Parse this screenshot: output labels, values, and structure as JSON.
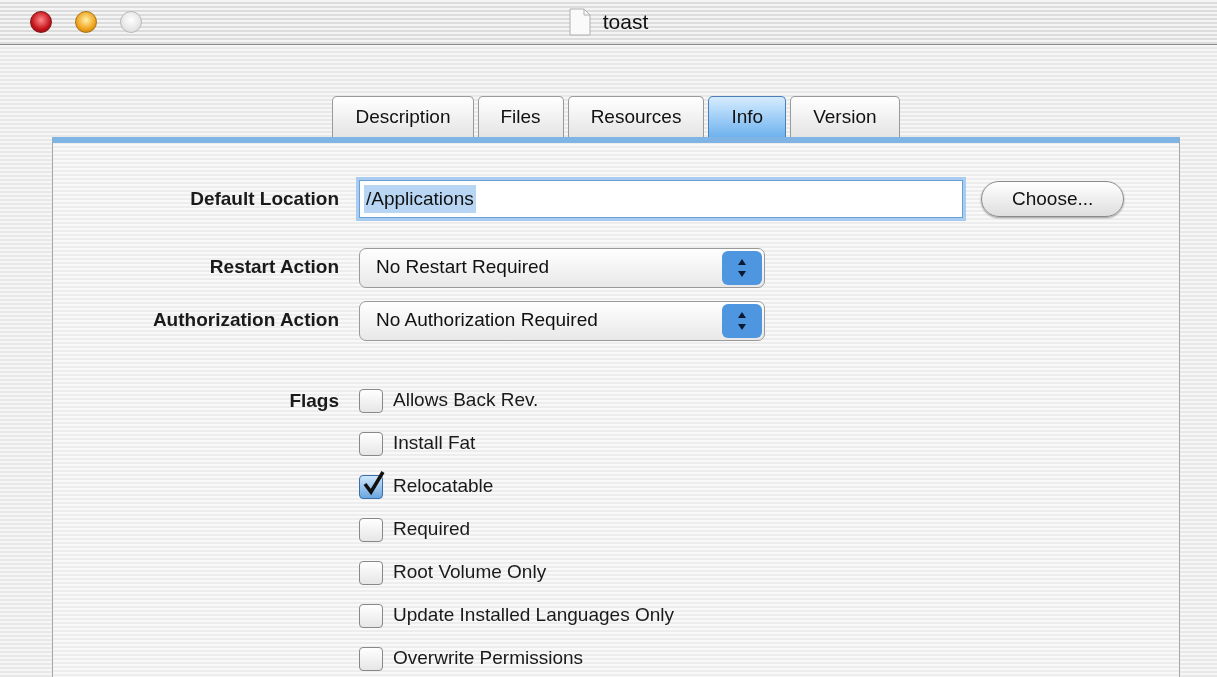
{
  "window": {
    "title": "toast"
  },
  "tabs": [
    {
      "label": "Description",
      "selected": false
    },
    {
      "label": "Files",
      "selected": false
    },
    {
      "label": "Resources",
      "selected": false
    },
    {
      "label": "Info",
      "selected": true
    },
    {
      "label": "Version",
      "selected": false
    }
  ],
  "default_location": {
    "label": "Default Location",
    "value": "/Applications",
    "focused": true,
    "button": "Choose..."
  },
  "popups": [
    {
      "label": "Restart Action",
      "value": "No Restart Required"
    },
    {
      "label": "Authorization Action",
      "value": "No Authorization Required"
    }
  ],
  "flags": {
    "label": "Flags",
    "items": [
      {
        "label": "Allows Back Rev.",
        "checked": false
      },
      {
        "label": "Install Fat",
        "checked": false
      },
      {
        "label": "Relocatable",
        "checked": true
      },
      {
        "label": "Required",
        "checked": false
      },
      {
        "label": "Root Volume Only",
        "checked": false
      },
      {
        "label": "Update Installed Languages Only",
        "checked": false
      },
      {
        "label": "Overwrite Permissions",
        "checked": false
      }
    ]
  }
}
